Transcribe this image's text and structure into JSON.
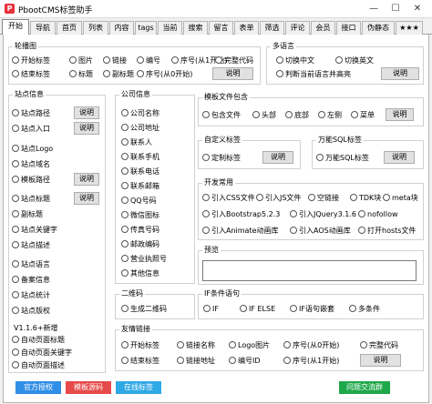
{
  "window": {
    "title": "PbootCMS标签助手",
    "icon_text": "P",
    "minimize": "—",
    "maximize": "☐",
    "close": "✕"
  },
  "tabs": [
    "开始",
    "导航",
    "首页",
    "列表",
    "内容",
    "tags",
    "当前",
    "搜索",
    "留言",
    "表单",
    "筛选",
    "评论",
    "会员",
    "接口",
    "伪静态",
    "★★★"
  ],
  "common": {
    "explain": "说明"
  },
  "carousel": {
    "title": "轮播图",
    "options": [
      "开始标签",
      "图片",
      "链接",
      "编号",
      "序号(从1开始)",
      "完整代码",
      "结束标签",
      "标题",
      "副标题",
      "序号(从0开始)"
    ]
  },
  "multilang": {
    "title": "多语言",
    "options": [
      "切换中文",
      "切换英文",
      "判断当前语言并高亮"
    ]
  },
  "site_info": {
    "title": "站点信息",
    "groups": [
      [
        "站点路径",
        "站点入口"
      ],
      [
        "站点Logo",
        "站点域名",
        "模板路径"
      ],
      [
        "站点标题",
        "副标题",
        "站点关键字",
        "站点描述"
      ],
      [
        "站点语言",
        "备案信息",
        "站点统计",
        "站点版权"
      ]
    ],
    "version": "V1.1.6+新增",
    "extra": [
      "自动页面标题",
      "自动页面关键字",
      "自动页面描述"
    ]
  },
  "company": {
    "title": "公司信息",
    "items": [
      "公司名称",
      "公司地址",
      "联系人",
      "联系手机",
      "联系电话",
      "联系邮箱",
      "QQ号码",
      "微信图标",
      "传真号码",
      "邮政编码",
      "营业执照号",
      "其他信息"
    ]
  },
  "template": {
    "title": "模板文件包含",
    "options": [
      "包含文件",
      "头部",
      "底部",
      "左侧",
      "菜单"
    ]
  },
  "custom": {
    "title": "自定义标签",
    "options": [
      "定制标签"
    ]
  },
  "sql": {
    "title": "万能SQL标签",
    "options": [
      "万能SQL标签"
    ]
  },
  "dev": {
    "title": "开发常用",
    "options": [
      "引入CSS文件",
      "引入JS文件",
      "空链接",
      "TDK块",
      "meta块",
      "引入Bootstrap5.2.3",
      "引入JQuery3.1.6",
      "nofollow",
      "引入Animate动画库",
      "引入AOS动画库",
      "打开hosts文件"
    ]
  },
  "preview": {
    "title": "预览"
  },
  "qrcode": {
    "title": "二维码",
    "options": [
      "生成二维码"
    ]
  },
  "ifcond": {
    "title": "IF条件语句",
    "options": [
      "IF",
      "IF ELSE",
      "IF语句嵌套",
      "多条件"
    ]
  },
  "links": {
    "title": "友情链接",
    "options": [
      "开始标签",
      "链接名称",
      "Logo图片",
      "序号(从0开始)",
      "完整代码",
      "结束标签",
      "链接地址",
      "编号ID",
      "序号(从1开始)"
    ]
  },
  "bottom": {
    "official_auth": "官方授权",
    "template_source": "模板源码",
    "online_tags": "在线标签",
    "qq_group": "问题交流群"
  },
  "colors": {
    "official_auth": "#2f8ee6",
    "template_source": "#e64a4a",
    "online_tags": "#2fa8e6",
    "qq_group": "#1fa84a"
  }
}
